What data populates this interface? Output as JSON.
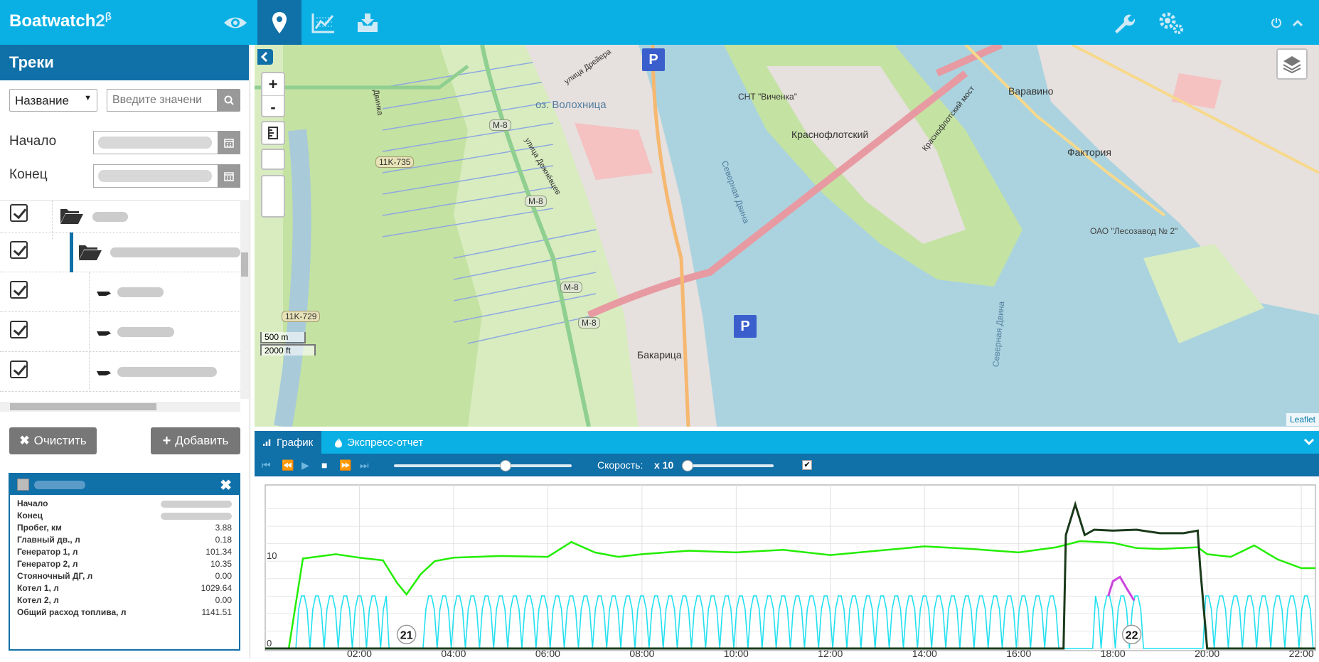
{
  "app": {
    "brand": "Boatwatch",
    "brand_version": "2",
    "brand_sup": "β"
  },
  "topnav": {
    "icons": [
      "eye-icon",
      "map-marker-icon",
      "line-chart-icon",
      "download-icon"
    ],
    "right_icons": [
      "wrench-icon",
      "gears-icon",
      "power-icon",
      "chevron-up-icon"
    ]
  },
  "sidebar": {
    "title": "Треки",
    "filter": {
      "selected": "Название",
      "placeholder": "Введите значени"
    },
    "start_label": "Начало",
    "end_label": "Конец",
    "clear_label": "Очистить",
    "add_label": "Добавить"
  },
  "info_panel": {
    "rows": [
      {
        "label": "Начало",
        "value": ""
      },
      {
        "label": "Конец",
        "value": ""
      },
      {
        "label": "Пробег, км",
        "value": "3.88"
      },
      {
        "label": "Главный дв., л",
        "value": "0.18"
      },
      {
        "label": "Генератор 1, л",
        "value": "101.34"
      },
      {
        "label": "Генератор 2, л",
        "value": "10.35"
      },
      {
        "label": "Стояночный ДГ, л",
        "value": "0.00"
      },
      {
        "label": "Котел 1, л",
        "value": "1029.64"
      },
      {
        "label": "Котел 2, л",
        "value": "0.00"
      },
      {
        "label": "Общий расход топлива, л",
        "value": "1141.51"
      }
    ]
  },
  "map": {
    "labels": {
      "lake": "оз. Волохница",
      "district1": "Краснофлотский",
      "district2": "Варавино",
      "district3": "Фактория",
      "district4": "Бакарица",
      "snt": "СНТ \"Виченка\"",
      "river": "Северная Двина",
      "bridge": "Краснофлотский мост",
      "street1": "улица Дрейера",
      "street2": "улица Дежнёвцев",
      "factory": "ОАО \"Лесозавод № 2\"",
      "road_m8": "M-8",
      "road_11k735": "11K-735",
      "road_11k729": "11K-729",
      "canal": "Двинка",
      "parking": "P"
    },
    "zoom_in": "+",
    "zoom_out": "-",
    "scale_m": "500 m",
    "scale_ft": "2000 ft",
    "attribution": "Leaflet"
  },
  "panel": {
    "tab_chart": "График",
    "tab_report": "Экспресс-отчет",
    "speed_label": "Скорость:",
    "speed_value": "x 10"
  },
  "colors": {
    "topbar": "#0ab0e4",
    "dark_blue": "#1070a8",
    "green_series": "#22ee00",
    "cyan_series": "#22e0f0",
    "dark_series": "#1a3a1a",
    "magenta_series": "#cc44dd"
  },
  "chart_data": {
    "type": "line",
    "x_ticks": [
      "02:00",
      "04:00",
      "06:00",
      "08:00",
      "10:00",
      "12:00",
      "14:00",
      "16:00",
      "18:00",
      "20:00",
      "22:00"
    ],
    "y_ticks": [
      "0",
      "10"
    ],
    "markers": [
      "21",
      "22"
    ],
    "xlim_hours": [
      0,
      22.3
    ],
    "ylim": [
      0,
      18
    ],
    "series": [
      {
        "color": "#22ee00",
        "x": [
          0.0,
          0.3,
          0.5,
          0.8,
          1.5,
          2.0,
          2.5,
          2.8,
          3.0,
          3.3,
          3.6,
          4.0,
          5.0,
          6.0,
          6.5,
          7.0,
          7.5,
          8.0,
          9.0,
          10.0,
          11.0,
          12.0,
          13.0,
          14.0,
          15.0,
          16.0,
          16.8,
          17.3,
          18.0,
          18.5,
          19.0,
          19.8,
          20.0,
          20.5,
          21.0,
          21.5,
          22.0,
          22.3
        ],
        "y": [
          0,
          0,
          0,
          10.3,
          10.8,
          10.4,
          10.1,
          7.5,
          6.2,
          8.5,
          10.0,
          10.4,
          10.6,
          10.5,
          12.2,
          11.0,
          10.5,
          10.8,
          11.2,
          11.0,
          11.3,
          10.7,
          11.2,
          11.7,
          11.4,
          11.0,
          11.6,
          12.3,
          12.1,
          11.5,
          11.4,
          11.6,
          10.8,
          10.5,
          11.8,
          10.2,
          9.2,
          9.2
        ]
      },
      {
        "color": "#1a3a1a",
        "x": [
          0.0,
          16.95,
          17.0,
          17.2,
          17.4,
          17.6,
          18.0,
          18.5,
          19.0,
          19.5,
          19.8,
          19.85,
          20.0,
          22.3
        ],
        "y": [
          0,
          0,
          13.0,
          16.5,
          13.0,
          13.6,
          13.5,
          13.6,
          13.2,
          13.2,
          13.5,
          9.5,
          0,
          0
        ]
      },
      {
        "color": "#cc44dd",
        "x": [
          17.9,
          18.0,
          18.15,
          18.3,
          18.45
        ],
        "y": [
          6.0,
          7.7,
          8.2,
          6.8,
          5.5
        ]
      }
    ]
  }
}
